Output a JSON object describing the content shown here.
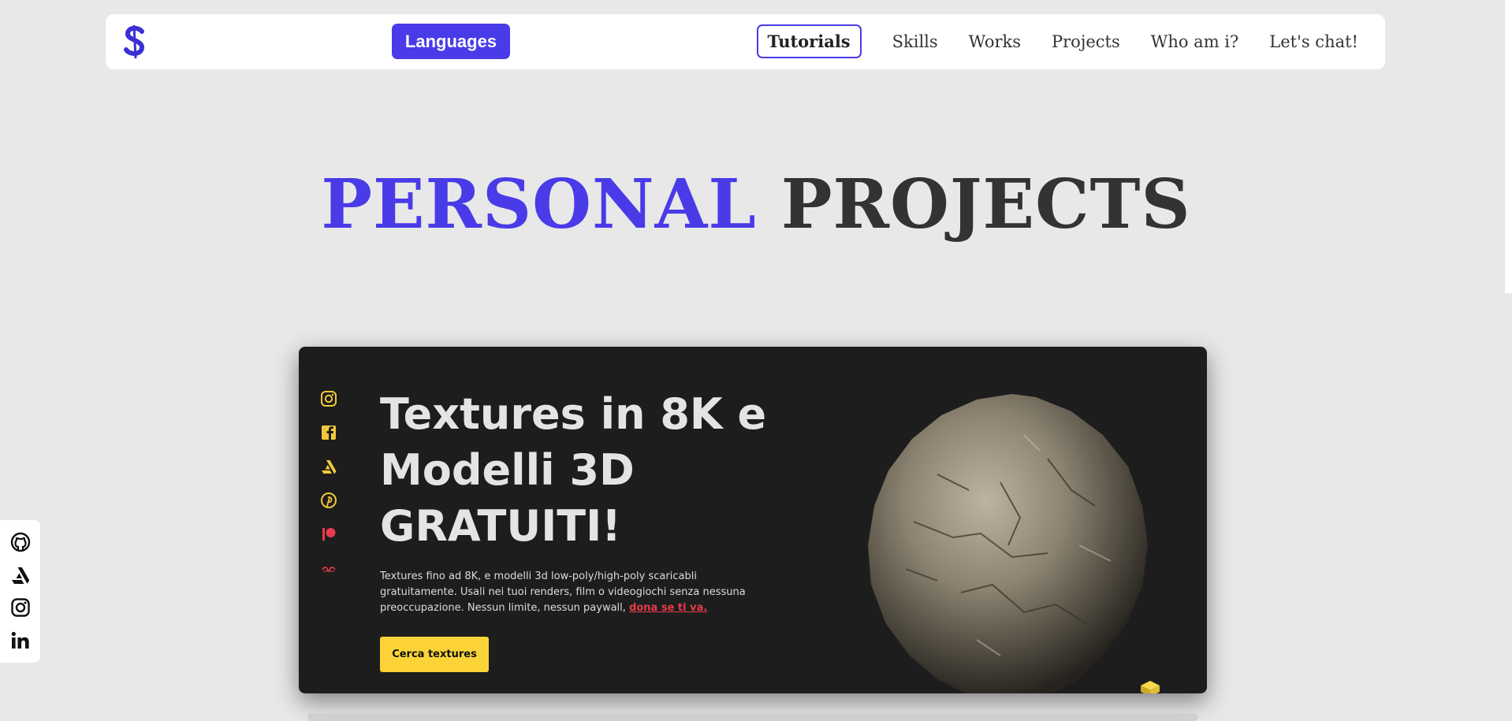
{
  "nav": {
    "logo_icon": "s-logo-icon",
    "languages_label": "Languages",
    "links": [
      {
        "label": "Tutorials",
        "active": true
      },
      {
        "label": "Skills"
      },
      {
        "label": "Works"
      },
      {
        "label": "Projects"
      },
      {
        "label": "Who am i?"
      },
      {
        "label": "Let's chat!"
      }
    ]
  },
  "hero": {
    "word1": "PERSONAL",
    "word2": "PROJECTS"
  },
  "card": {
    "social_icons": [
      "instagram-icon",
      "facebook-icon",
      "artstation-icon",
      "pinterest-icon",
      "patreon-icon",
      "blender-market-icon"
    ],
    "title_line1": "Textures in 8K e",
    "title_line2": "Modelli 3D",
    "title_line3": "GRATUITI!",
    "desc_text": "Textures fino ad 8K, e modelli 3d low-poly/high-poly scaricabli gratuitamente. Usali nei tuoi renders, film o videogiochi senza nessuna preoccupazione. Nessun limite, nessun paywall, ",
    "desc_link": "dona se ti va.",
    "button_label": "Cerca textures"
  },
  "dock": {
    "icons": [
      "github-icon",
      "artstation-icon",
      "instagram-icon",
      "linkedin-icon"
    ]
  },
  "colors": {
    "accent": "#4a3be8",
    "card_bg": "#1d1d1d",
    "card_button": "#fbd338",
    "card_link": "#e83a4a",
    "card_icon": "#f2c83a"
  }
}
